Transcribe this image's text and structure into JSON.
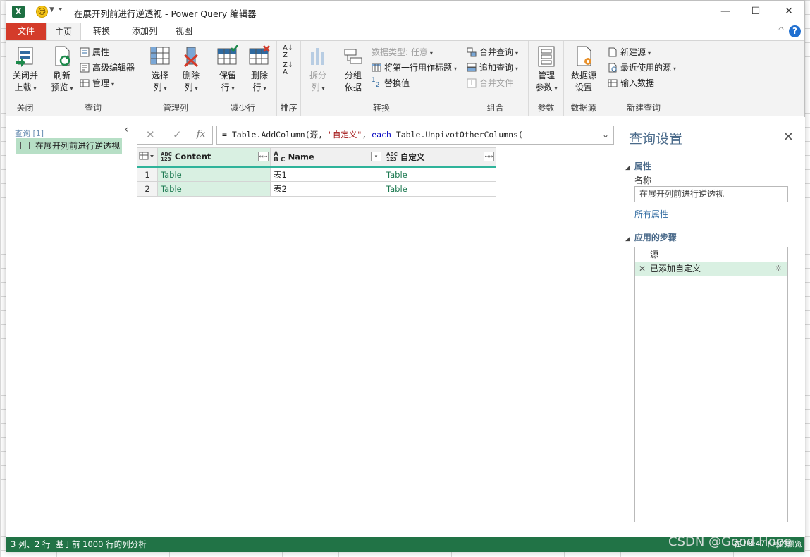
{
  "window": {
    "title": "在展开列前进行逆透视 - Power Query 编辑器",
    "app_icon": "excel-icon",
    "controls": {
      "minimize": "—",
      "maximize": "☐",
      "close": "✕"
    }
  },
  "tabs": [
    {
      "label": "文件"
    },
    {
      "label": "主页"
    },
    {
      "label": "转换"
    },
    {
      "label": "添加列"
    },
    {
      "label": "视图"
    }
  ],
  "ribbon": {
    "close_group": {
      "label": "关闭",
      "close_load": "关闭并\n上载"
    },
    "query_group": {
      "label": "查询",
      "refresh": "刷新\n预览",
      "properties": "属性",
      "advanced_editor": "高级编辑器",
      "manage": "管理"
    },
    "manage_cols_group": {
      "label": "管理列",
      "choose_cols": "选择\n列",
      "remove_cols": "删除\n列"
    },
    "reduce_rows_group": {
      "label": "减少行",
      "keep_rows": "保留\n行",
      "remove_rows": "删除\n行"
    },
    "sort_group": {
      "label": "排序"
    },
    "transform_group": {
      "label": "转换",
      "split_col": "拆分\n列",
      "group_by": "分组\n依据",
      "data_type": "数据类型: 任意",
      "first_row_header": "将第一行用作标题",
      "replace_values": "替换值"
    },
    "combine_group": {
      "label": "组合",
      "merge_queries": "合并查询",
      "append_queries": "追加查询",
      "combine_files": "合并文件"
    },
    "params_group": {
      "label": "参数",
      "manage_params": "管理\n参数"
    },
    "datasource_group": {
      "label": "数据源",
      "ds_settings": "数据源\n设置"
    },
    "newquery_group": {
      "label": "新建查询",
      "new_source": "新建源",
      "recent_sources": "最近使用的源",
      "enter_data": "输入数据"
    }
  },
  "queries_pane": {
    "header": "查询 [1]",
    "items": [
      {
        "label": "在展开列前进行逆透视"
      }
    ]
  },
  "formula_bar": {
    "fx": "fx",
    "formula_prefix": "= Table.AddColumn(源, ",
    "formula_string": "\"自定义\"",
    "formula_mid": ", ",
    "formula_kw": "each",
    "formula_suffix": " Table.UnpivotOtherColumns("
  },
  "grid": {
    "columns": [
      {
        "name": "Content",
        "type_top": "ABC",
        "type_bottom": "123"
      },
      {
        "name": "Name",
        "type_top": "A",
        "type_bottom": "B C"
      },
      {
        "name": "自定义",
        "type_top": "ABC",
        "type_bottom": "123"
      }
    ],
    "rows": [
      {
        "num": "1",
        "content": "Table",
        "name": "表1",
        "custom": "Table"
      },
      {
        "num": "2",
        "content": "Table",
        "name": "表2",
        "custom": "Table"
      }
    ]
  },
  "query_settings": {
    "title": "查询设置",
    "properties_title": "属性",
    "name_label": "名称",
    "name_value": "在展开列前进行逆透视",
    "all_properties": "所有属性",
    "steps_title": "应用的步骤",
    "steps": [
      {
        "label": "源"
      },
      {
        "label": "已添加自定义"
      }
    ]
  },
  "status": {
    "left": "3 列、2 行",
    "profile": "基于前 1000 行的列分析",
    "right": "在 08:47下载的预览"
  },
  "watermark": "CSDN @Good Hope",
  "colors": {
    "accent_green": "#217346",
    "file_tab": "#d43b2a",
    "selection": "#d9f0e2"
  }
}
